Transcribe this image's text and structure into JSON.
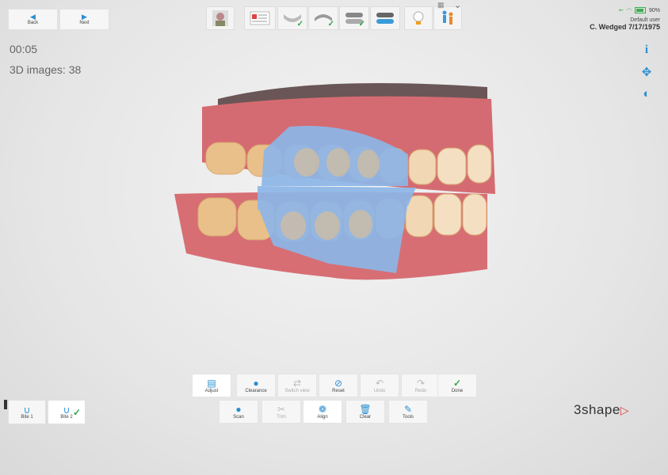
{
  "nav": {
    "back_label": "Back",
    "next_label": "Next"
  },
  "status": {
    "battery": "90%",
    "user": "Default user",
    "patient": "C. Wedged 7/17/1975"
  },
  "scan": {
    "timer": "00:05",
    "images": "3D images: 38"
  },
  "toolbar_row1": [
    {
      "label": "Adjust",
      "icon": "adjust-icon",
      "state": "active"
    },
    {
      "label": "Clearance",
      "icon": "clearance-icon",
      "state": "normal"
    },
    {
      "label": "Switch view",
      "icon": "switch-view-icon",
      "state": "disabled"
    },
    {
      "label": "Reset",
      "icon": "reset-icon",
      "state": "normal"
    },
    {
      "label": "Undo",
      "icon": "undo-icon",
      "state": "disabled"
    },
    {
      "label": "Redo",
      "icon": "redo-icon",
      "state": "disabled"
    },
    {
      "label": "Done",
      "icon": "check-icon",
      "state": "normal"
    }
  ],
  "toolbar_row2": [
    {
      "label": "Scan",
      "icon": "scan-icon",
      "state": "normal"
    },
    {
      "label": "Trim",
      "icon": "trim-icon",
      "state": "disabled"
    },
    {
      "label": "Align",
      "icon": "align-icon",
      "state": "active"
    },
    {
      "label": "Clear",
      "icon": "trash-icon",
      "state": "normal"
    },
    {
      "label": "Tools",
      "icon": "tools-icon",
      "state": "normal"
    }
  ],
  "bites": [
    {
      "label": "Bite 1"
    },
    {
      "label": "Bite 2",
      "done": true
    }
  ],
  "logo": "3shape",
  "colors": {
    "accent": "#2a8fd0",
    "check": "#2fa84a",
    "scan_overlay": "#8db6e8",
    "gum": "#d86a72",
    "tooth": "#e8c08c"
  }
}
